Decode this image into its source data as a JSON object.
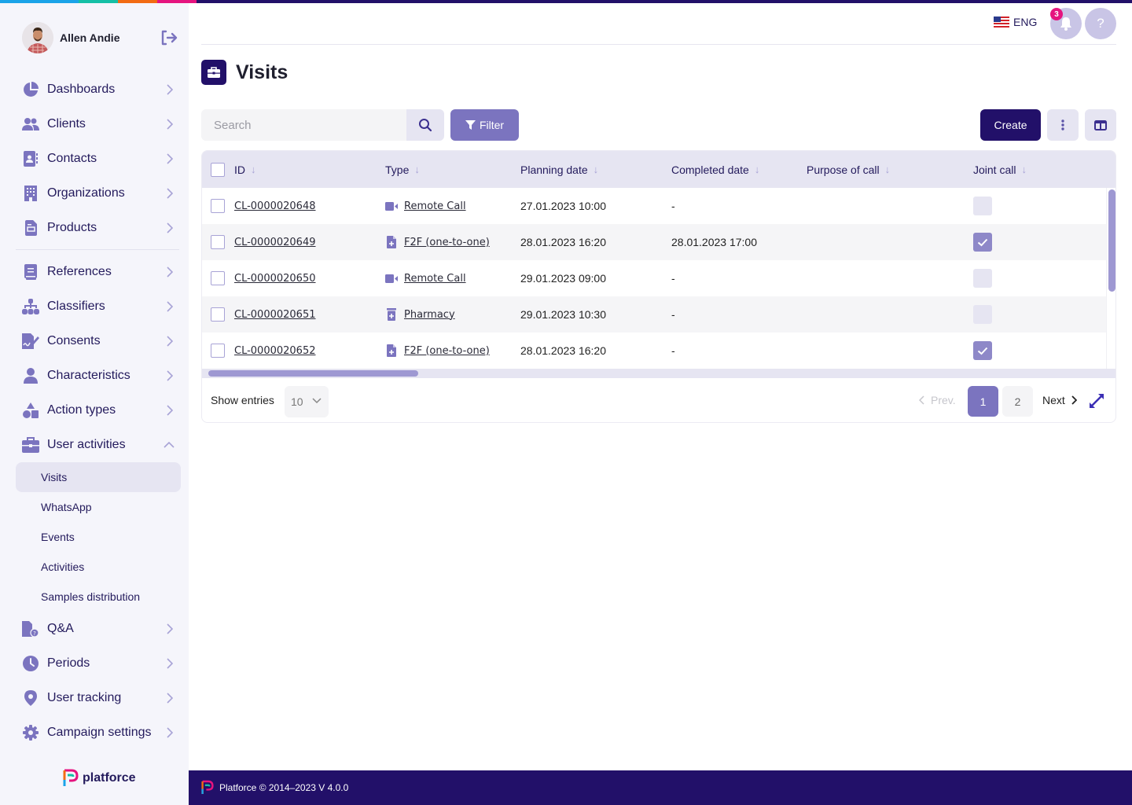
{
  "theme": {
    "primary": "#221069",
    "accent": "#7b74bf",
    "accent_light": "#e6e5f2",
    "badge": "#e5147f",
    "strip": [
      "#1aa3e8",
      "#15bfa6",
      "#f26b13",
      "#e5147f",
      "#221069"
    ]
  },
  "user": {
    "name": "Allen Andie",
    "logout_icon": "logout-icon"
  },
  "sidebar": {
    "items": [
      {
        "label": "Dashboards",
        "icon": "pie-chart-icon"
      },
      {
        "label": "Clients",
        "icon": "users-icon"
      },
      {
        "label": "Contacts",
        "icon": "contact-book-icon"
      },
      {
        "label": "Organizations",
        "icon": "building-icon"
      },
      {
        "label": "Products",
        "icon": "document-icon"
      },
      {
        "label": "References",
        "icon": "book-icon"
      },
      {
        "label": "Classifiers",
        "icon": "hierarchy-icon"
      },
      {
        "label": "Consents",
        "icon": "signature-icon"
      },
      {
        "label": "Characteristics",
        "icon": "person-icon"
      },
      {
        "label": "Action types",
        "icon": "shapes-icon"
      },
      {
        "label": "User activities",
        "icon": "briefcase-icon",
        "expanded": true
      }
    ],
    "subitems": [
      {
        "label": "Visits",
        "active": true
      },
      {
        "label": "WhatsApp"
      },
      {
        "label": "Events"
      },
      {
        "label": "Activities"
      },
      {
        "label": "Samples distribution"
      }
    ],
    "bottom_items": [
      {
        "label": "Q&A",
        "icon": "question-file-icon"
      },
      {
        "label": "Periods",
        "icon": "clock-icon"
      },
      {
        "label": "User tracking",
        "icon": "location-pin-icon"
      },
      {
        "label": "Campaign settings",
        "icon": "gear-icon"
      }
    ],
    "brand": "platforce"
  },
  "header": {
    "language": "ENG",
    "notifications_count": "3",
    "help_label": "?"
  },
  "page": {
    "title": "Visits",
    "search_placeholder": "Search",
    "filter_label": "Filter",
    "create_label": "Create"
  },
  "table": {
    "columns": [
      "ID",
      "Type",
      "Planning date",
      "Completed date",
      "Purpose of call",
      "Joint call"
    ],
    "rows": [
      {
        "id": "CL-0000020648",
        "type": "Remote Call",
        "type_icon": "video-camera-icon",
        "planning": "27.01.2023 10:00",
        "completed": "-",
        "purpose": "",
        "joint": false
      },
      {
        "id": "CL-0000020649",
        "type": "F2F (one-to-one)",
        "type_icon": "file-plus-icon",
        "planning": "28.01.2023 16:20",
        "completed": "28.01.2023 17:00",
        "purpose": "",
        "joint": true
      },
      {
        "id": "CL-0000020650",
        "type": "Remote Call",
        "type_icon": "video-camera-icon",
        "planning": "29.01.2023 09:00",
        "completed": "-",
        "purpose": "",
        "joint": false
      },
      {
        "id": "CL-0000020651",
        "type": "Pharmacy",
        "type_icon": "pharmacy-icon",
        "planning": "29.01.2023 10:30",
        "completed": "-",
        "purpose": "",
        "joint": false
      },
      {
        "id": "CL-0000020652",
        "type": "F2F (one-to-one)",
        "type_icon": "file-plus-icon",
        "planning": "28.01.2023 16:20",
        "completed": "-",
        "purpose": "",
        "joint": true
      }
    ]
  },
  "pagination": {
    "show_entries_label": "Show entries",
    "entries_value": "10",
    "prev_label": "Prev.",
    "next_label": "Next",
    "pages": [
      "1",
      "2"
    ],
    "current_page": "1"
  },
  "footer": {
    "text": "Platforce © 2014–2023 V 4.0.0"
  }
}
